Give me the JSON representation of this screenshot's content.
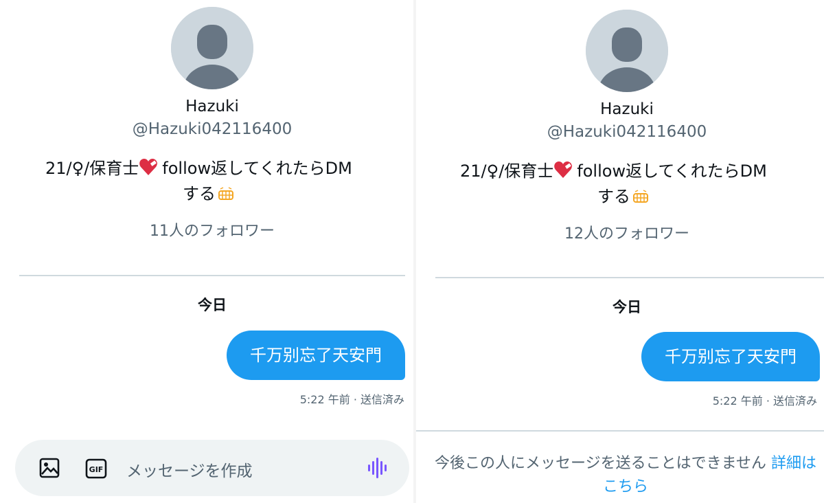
{
  "left_panel": {
    "profile": {
      "name": "Hazuki",
      "handle": "@Hazuki042116400",
      "bio_line1": "21/♀/保育士",
      "bio_line1_tail": "follow返してくれたらDM",
      "bio_line2": "する",
      "followers": "11人のフォロワー"
    },
    "conversation": {
      "day_label": "今日",
      "message": "千万别忘了天安門",
      "timestamp": "5:22 午前 · 送信済み"
    },
    "composer": {
      "placeholder": "メッセージを作成",
      "icons": [
        "image-icon",
        "gif-icon",
        "voice-icon"
      ]
    }
  },
  "right_panel": {
    "profile": {
      "name": "Hazuki",
      "handle": "@Hazuki042116400",
      "bio_line1": "21/♀/保育士",
      "bio_line1_tail": "follow返してくれたらDM",
      "bio_line2": "する",
      "followers": "12人のフォロワー"
    },
    "conversation": {
      "day_label": "今日",
      "message": "千万别忘了天安門",
      "timestamp": "5:22 午前 · 送信済み"
    },
    "notice": {
      "text": "今後この人にメッセージを送ることはできません",
      "link": "詳細はこちら"
    }
  },
  "colors": {
    "accent": "#1d9bf0",
    "text_primary": "#0f1419",
    "text_secondary": "#536471",
    "divider": "#cfd9de",
    "avatar_bg": "#ccd6dd",
    "avatar_fg": "#687684",
    "composer_bg": "#eff3f4",
    "voice_icon": "#7856ff"
  }
}
